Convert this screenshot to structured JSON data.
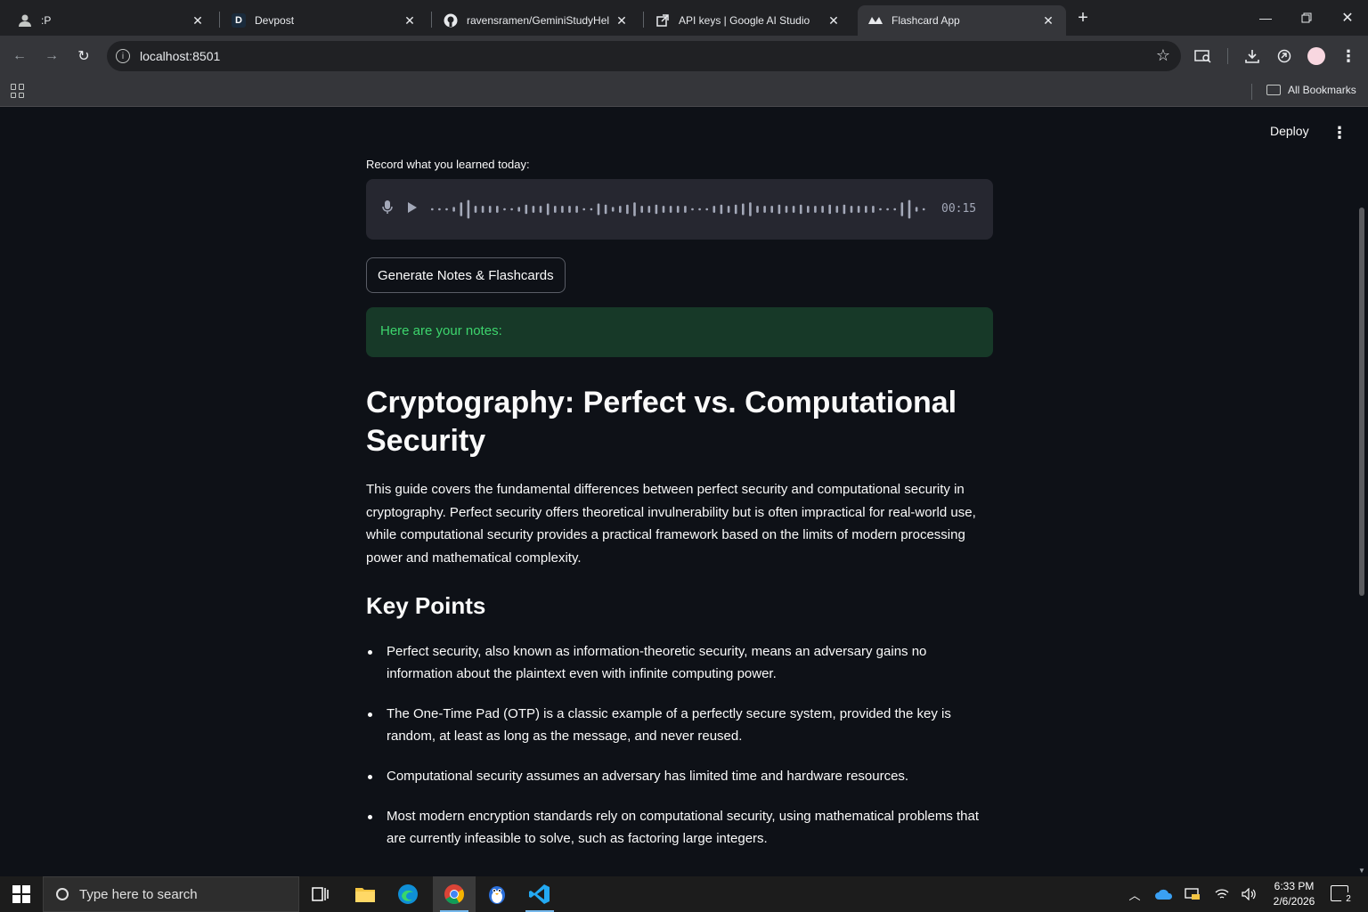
{
  "browser": {
    "tabs": [
      {
        "label": ":P",
        "icon": "profile-icon"
      },
      {
        "label": "Devpost",
        "icon": "devpost-icon",
        "glyph": "D"
      },
      {
        "label": "ravensramen/GeminiStudyHelp",
        "icon": "github-icon"
      },
      {
        "label": "API keys | Google AI Studio",
        "icon": "ai-studio-icon"
      },
      {
        "label": "Flashcard App",
        "icon": "streamlit-icon",
        "active": true
      }
    ],
    "url": "localhost:8501",
    "bookmarks_label": "All Bookmarks"
  },
  "app": {
    "deploy_label": "Deploy",
    "record_label": "Record what you learned today:",
    "audio_time": "00:15",
    "generate_button": "Generate Notes & Flashcards",
    "success_message": "Here are your notes:",
    "notes": {
      "title": "Cryptography: Perfect vs. Computational Security",
      "summary": "This guide covers the fundamental differences between perfect security and computational security in cryptography. Perfect security offers theoretical invulnerability but is often impractical for real-world use, while computational security provides a practical framework based on the limits of modern processing power and mathematical complexity.",
      "key_points_heading": "Key Points",
      "key_points": [
        "Perfect security, also known as information-theoretic security, means an adversary gains no information about the plaintext even with infinite computing power.",
        "The One-Time Pad (OTP) is a classic example of a perfectly secure system, provided the key is random, at least as long as the message, and never reused.",
        "Computational security assumes an adversary has limited time and hardware resources.",
        "Most modern encryption standards rely on computational security, using mathematical problems that are currently infeasible to solve, such as factoring large integers."
      ]
    }
  },
  "taskbar": {
    "search_placeholder": "Type here to search",
    "time": "6:33 PM",
    "date": "2/6/2026",
    "notification_count": "2"
  },
  "colors": {
    "app_bg": "#0e1117",
    "success_bg": "#173928",
    "success_text": "#3dd56d",
    "audio_bg": "#262730"
  }
}
